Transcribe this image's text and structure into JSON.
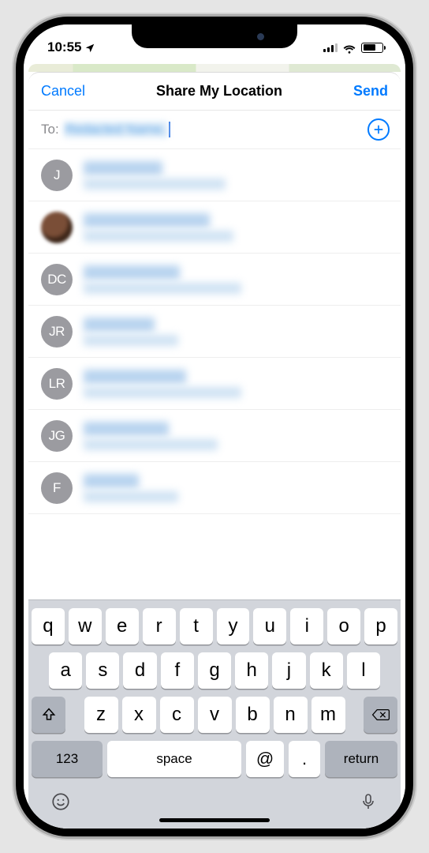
{
  "status": {
    "time": "10:55",
    "signal": 3,
    "wifi": true,
    "battery_pct": 58
  },
  "nav": {
    "cancel": "Cancel",
    "title": "Share My Location",
    "send": "Send"
  },
  "to": {
    "label": "To:",
    "token": "Redacted Name,"
  },
  "contacts": [
    {
      "initials": "J",
      "photo": false,
      "name_w": 100,
      "detail_w": 180
    },
    {
      "initials": "",
      "photo": true,
      "name_w": 160,
      "detail_w": 190
    },
    {
      "initials": "DC",
      "photo": false,
      "name_w": 122,
      "detail_w": 200
    },
    {
      "initials": "JR",
      "photo": false,
      "name_w": 90,
      "detail_w": 120
    },
    {
      "initials": "LR",
      "photo": false,
      "name_w": 130,
      "detail_w": 200
    },
    {
      "initials": "JG",
      "photo": false,
      "name_w": 108,
      "detail_w": 170
    },
    {
      "initials": "F",
      "photo": false,
      "name_w": 70,
      "detail_w": 120
    }
  ],
  "keyboard": {
    "row1": [
      "q",
      "w",
      "e",
      "r",
      "t",
      "y",
      "u",
      "i",
      "o",
      "p"
    ],
    "row2": [
      "a",
      "s",
      "d",
      "f",
      "g",
      "h",
      "j",
      "k",
      "l"
    ],
    "row3": [
      "z",
      "x",
      "c",
      "v",
      "b",
      "n",
      "m"
    ],
    "k123": "123",
    "space": "space",
    "at": "@",
    "dot": ".",
    "ret": "return"
  }
}
